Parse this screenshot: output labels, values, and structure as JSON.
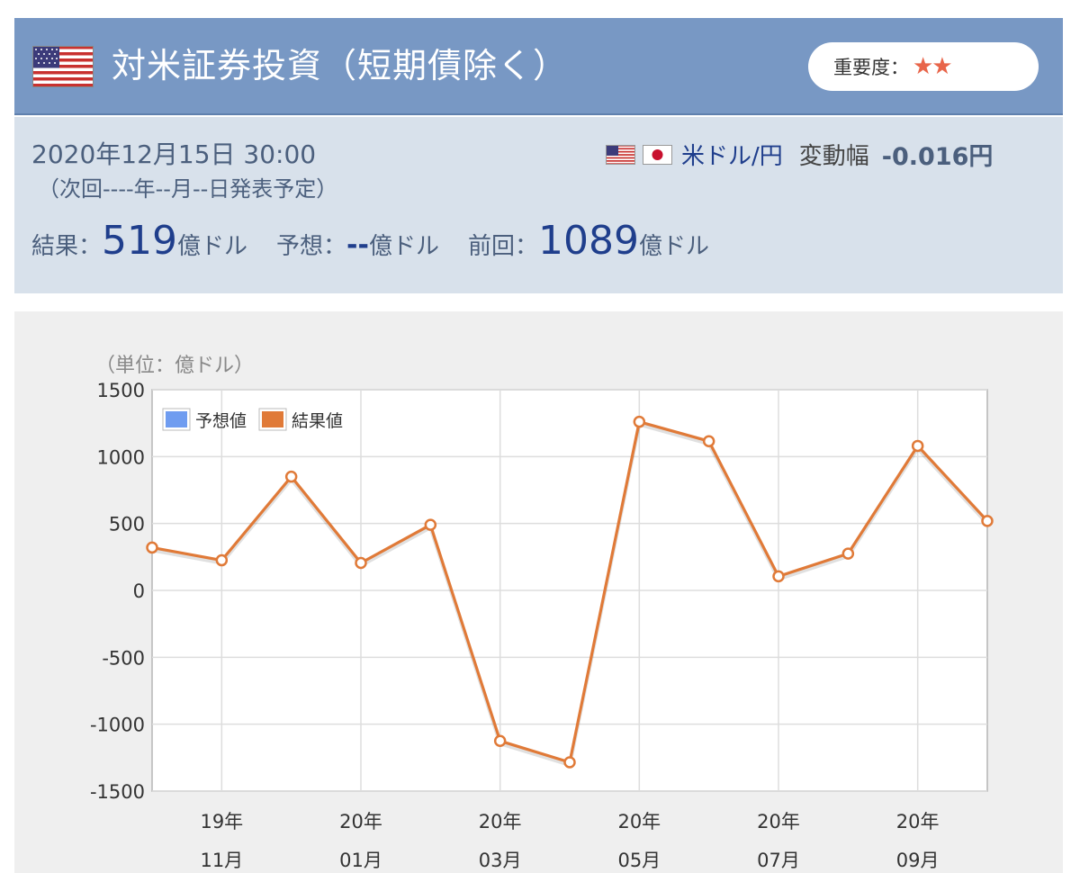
{
  "header": {
    "title": "対米証券投資（短期債除く）",
    "importance_label": "重要度：",
    "importance_stars": "★★",
    "flag_icon": "us-flag-icon"
  },
  "info": {
    "datetime": "2020年12月15日 30:00",
    "next_release": "（次回----年--月--日発表予定）",
    "pair_name": "米ドル/円",
    "pair_change_label": "変動幅",
    "pair_change_value": "-0.016円",
    "result_label": "結果：",
    "result_value": "519",
    "result_unit": "億ドル",
    "forecast_label": "予想：",
    "forecast_value": "--",
    "forecast_unit": "億ドル",
    "previous_label": "前回：",
    "previous_value": "1089",
    "previous_unit": "億ドル"
  },
  "colors": {
    "header_bg": "#7898c4",
    "info_bg": "#d8e1eb",
    "series_result": "#e07a38",
    "series_forecast": "#6f9cf0",
    "stars": "#e8654a"
  },
  "chart_data": {
    "type": "line",
    "unit_label": "（単位：億ドル）",
    "ylim": [
      -1500,
      1500
    ],
    "yticks": [
      1500,
      1000,
      500,
      0,
      -500,
      -1000,
      -1500
    ],
    "xtick_labels": [
      {
        "year": "19年",
        "month": "11月"
      },
      {
        "year": "20年",
        "month": "01月"
      },
      {
        "year": "20年",
        "month": "03月"
      },
      {
        "year": "20年",
        "month": "05月"
      },
      {
        "year": "20年",
        "month": "07月"
      },
      {
        "year": "20年",
        "month": "09月"
      }
    ],
    "x": [
      "2019-10",
      "2019-11",
      "2019-12",
      "2020-01",
      "2020-02",
      "2020-03",
      "2020-04",
      "2020-05",
      "2020-06",
      "2020-07",
      "2020-08",
      "2020-09",
      "2020-10"
    ],
    "series": [
      {
        "name": "予想値",
        "values": []
      },
      {
        "name": "結果値",
        "values": [
          320,
          225,
          850,
          205,
          490,
          -1125,
          -1285,
          1260,
          1115,
          105,
          275,
          1080,
          519
        ]
      }
    ],
    "grid": true,
    "legend": "top-left"
  }
}
